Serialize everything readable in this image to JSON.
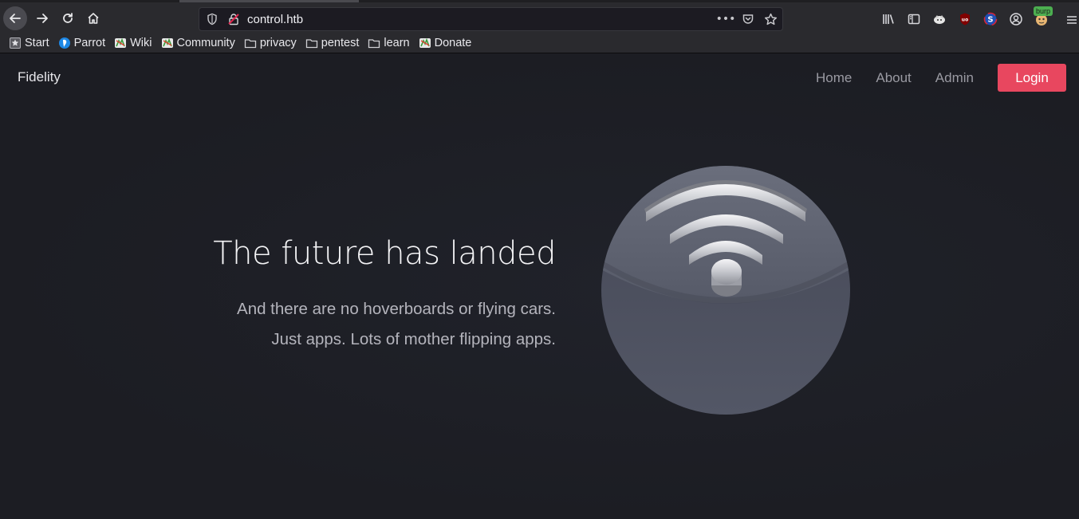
{
  "browser": {
    "url": "control.htb",
    "bookmarks": [
      {
        "label": "Start",
        "icon": "star-page-icon"
      },
      {
        "label": "Parrot",
        "icon": "parrot-icon"
      },
      {
        "label": "Wiki",
        "icon": "parrot-wiki-icon"
      },
      {
        "label": "Community",
        "icon": "parrot-community-icon"
      },
      {
        "label": "privacy",
        "icon": "folder-icon"
      },
      {
        "label": "pentest",
        "icon": "folder-icon"
      },
      {
        "label": "learn",
        "icon": "folder-icon"
      },
      {
        "label": "Donate",
        "icon": "parrot-donate-icon"
      }
    ],
    "burp_badge": "burp"
  },
  "site": {
    "brand": "Fidelity",
    "nav": [
      "Home",
      "About",
      "Admin"
    ],
    "login_label": "Login",
    "accent_color": "#e8475f"
  },
  "hero": {
    "title": "The future has landed",
    "line1": "And there are no hoverboards or flying cars.",
    "line2": "Just apps. Lots of mother flipping apps."
  }
}
